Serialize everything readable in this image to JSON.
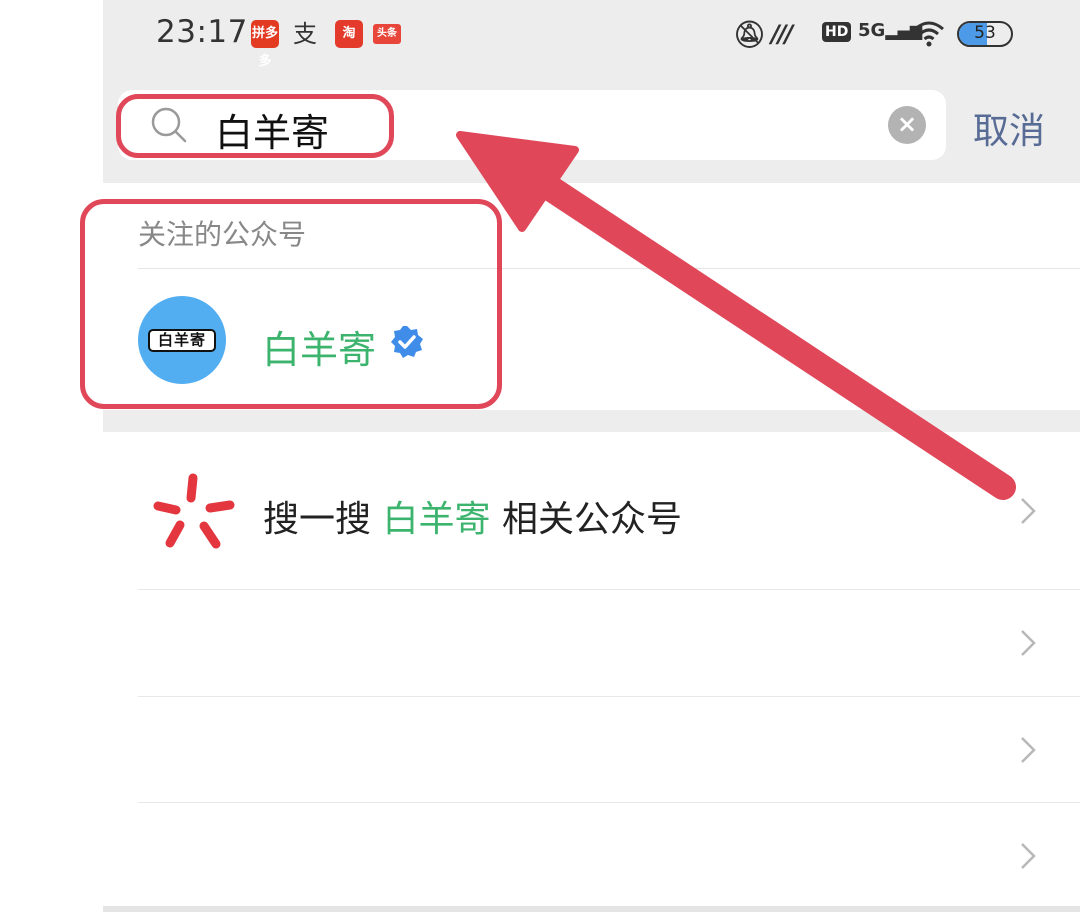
{
  "status_bar": {
    "time": "23:17",
    "app_icons": [
      "拼多多",
      "支",
      "淘",
      "头条"
    ],
    "network_text": "5G",
    "hd_text": "HD",
    "battery_level": "53"
  },
  "search": {
    "query": "白羊寄",
    "cancel_label": "取消"
  },
  "followed_section": {
    "title": "关注的公众号",
    "account": {
      "name": "白羊寄",
      "avatar_text": "白羊寄",
      "verified": true
    }
  },
  "sousou": {
    "prefix": "搜一搜",
    "keyword": "白羊寄",
    "suffix": "相关公众号"
  },
  "result_rows": 3,
  "colors": {
    "accent_green": "#3cb46e",
    "link_blue": "#576b95",
    "annotation_red": "#e0485a",
    "sousou_red": "#e3363f",
    "verified_blue": "#3f8de8"
  }
}
